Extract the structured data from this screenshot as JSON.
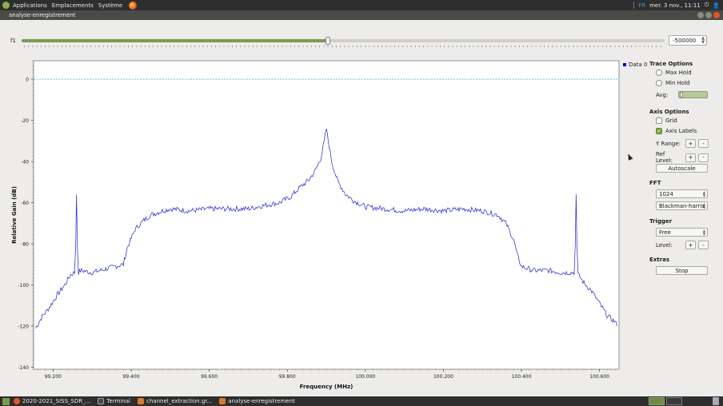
{
  "topbar": {
    "menus": [
      "Applications",
      "Emplacements",
      "Système"
    ],
    "lang": "FR",
    "clock": "mer. 3 nov., 11:11"
  },
  "window": {
    "title": "analyse-enregistrement"
  },
  "control": {
    "f1_label": "f1",
    "f1_value": "-500000",
    "slider_fraction": 0.476
  },
  "panel": {
    "trace_options": "Trace Options",
    "max_hold": "Max Hold",
    "min_hold": "Min Hold",
    "avg": "Avg:",
    "axis_options": "Axis Options",
    "grid": "Grid",
    "axis_labels": "Axis Labels",
    "y_range": "Y Range:",
    "ref_level": "Ref Level:",
    "plus": "+",
    "minus": "-",
    "autoscale": "Autoscale",
    "fft": "FFT",
    "fft_size": "1024",
    "window_fn": "Blackman-harris",
    "trigger": "Trigger",
    "trigger_mode": "Free",
    "level": "Level:",
    "extras": "Extras",
    "stop": "Stop"
  },
  "chart_data": {
    "type": "line",
    "xlabel": "Frequency (MHz)",
    "ylabel": "Relative Gain (dB)",
    "x_ticks": [
      99.2,
      99.4,
      99.6,
      99.8,
      100.0,
      100.2,
      100.4,
      100.6
    ],
    "x_tick_labels": [
      "99.200",
      "99.400",
      "99.600",
      "99.800",
      "100.000",
      "100.200",
      "100.400",
      "100.600"
    ],
    "y_ticks": [
      0,
      -20,
      -40,
      -60,
      -80,
      -100,
      -120,
      -140
    ],
    "y_tick_labels": [
      "0",
      "-20",
      "-40",
      "-60",
      "-80",
      "-100",
      "-120",
      "-140"
    ],
    "xlim": [
      99.15,
      100.65
    ],
    "ylim": [
      -141,
      9
    ],
    "grid": false,
    "legend": "Data 0",
    "legend_position": "top-right",
    "colors": {
      "trace": "#2222cc",
      "ref_line": "#2fb6d0"
    },
    "reference_line_y": 0,
    "series": [
      {
        "name": "Data 0",
        "x": [
          99.155,
          99.17,
          99.19,
          99.21,
          99.23,
          99.245,
          99.255,
          99.258,
          99.26,
          99.262,
          99.265,
          99.27,
          99.3,
          99.34,
          99.38,
          99.39,
          99.41,
          99.43,
          99.45,
          99.48,
          99.5,
          99.55,
          99.6,
          99.65,
          99.7,
          99.75,
          99.78,
          99.81,
          99.83,
          99.855,
          99.87,
          99.885,
          99.895,
          99.9,
          99.905,
          99.915,
          99.93,
          99.95,
          99.97,
          100.0,
          100.05,
          100.1,
          100.15,
          100.2,
          100.25,
          100.3,
          100.34,
          100.36,
          100.38,
          100.39,
          100.4,
          100.43,
          100.47,
          100.5,
          100.52,
          100.535,
          100.538,
          100.54,
          100.542,
          100.545,
          100.56,
          100.58,
          100.6,
          100.62,
          100.64,
          100.645
        ],
        "y": [
          -121,
          -116,
          -111,
          -105,
          -100,
          -95,
          -94,
          -80,
          -56,
          -80,
          -94,
          -93,
          -94,
          -92,
          -90,
          -82,
          -73,
          -69,
          -66,
          -64,
          -63,
          -64,
          -63,
          -63,
          -63,
          -61,
          -60,
          -57,
          -53,
          -49,
          -45,
          -39,
          -30,
          -24,
          -30,
          -41,
          -50,
          -56,
          -59,
          -62,
          -63,
          -64,
          -63,
          -64,
          -63,
          -64,
          -66,
          -70,
          -78,
          -86,
          -91,
          -93,
          -93,
          -94,
          -94,
          -94,
          -80,
          -56,
          -80,
          -95,
          -99,
          -103,
          -109,
          -115,
          -118,
          -120
        ]
      }
    ]
  },
  "taskbar": {
    "items": [
      "2020-2021_SISS_SDR_...",
      "Terminal",
      "channel_extraction.gr...",
      "analyse-enregistrement"
    ]
  }
}
